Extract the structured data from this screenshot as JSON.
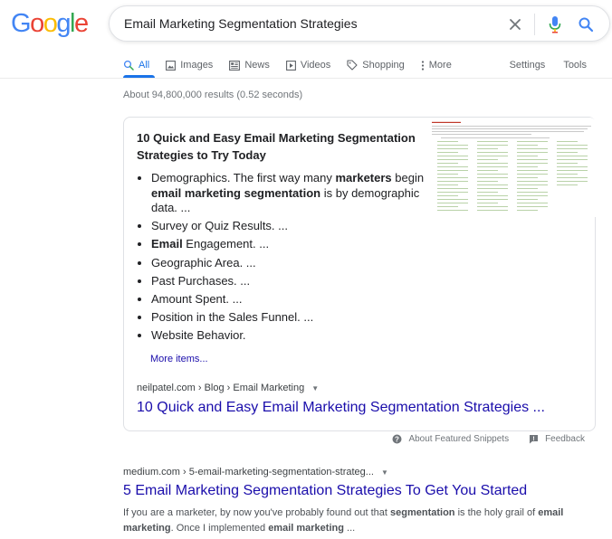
{
  "logo": {
    "letters": [
      "G",
      "o",
      "o",
      "g",
      "l",
      "e"
    ],
    "colors": [
      "#4285F4",
      "#EA4335",
      "#FBBC05",
      "#4285F4",
      "#34A853",
      "#EA4335"
    ]
  },
  "search": {
    "query": "Email Marketing Segmentation Strategies",
    "clear_icon": "close-icon",
    "mic_icon": "mic-icon",
    "search_icon": "search-icon"
  },
  "tabs": {
    "items": [
      {
        "label": "All",
        "icon": "search-icon",
        "active": true
      },
      {
        "label": "Images",
        "icon": "image-icon"
      },
      {
        "label": "News",
        "icon": "news-icon"
      },
      {
        "label": "Videos",
        "icon": "video-icon"
      },
      {
        "label": "Shopping",
        "icon": "tag-icon"
      },
      {
        "label": "More",
        "icon": "more-vert-icon"
      }
    ],
    "settings": "Settings",
    "tools": "Tools"
  },
  "stats": "About 94,800,000 results (0.52 seconds)",
  "featured_snippet": {
    "heading": "10 Quick and Easy Email Marketing Segmentation Strategies to Try Today",
    "items": [
      [
        {
          "t": "Demographics. The first way many "
        },
        {
          "t": "marketers",
          "b": true
        },
        {
          "t": " begin "
        },
        {
          "t": "email marketing segmentation",
          "b": true
        },
        {
          "t": " is by demographic data. ..."
        }
      ],
      [
        {
          "t": "Survey or Quiz Results. ..."
        }
      ],
      [
        {
          "t": "Email",
          "b": true
        },
        {
          "t": " Engagement. ..."
        }
      ],
      [
        {
          "t": "Geographic Area. ..."
        }
      ],
      [
        {
          "t": "Past Purchases. ..."
        }
      ],
      [
        {
          "t": "Amount Spent. ..."
        }
      ],
      [
        {
          "t": "Position in the Sales Funnel. ..."
        }
      ],
      [
        {
          "t": "Website Behavior."
        }
      ]
    ],
    "more_items": "More items...",
    "cite": "neilpatel.com › Blog › Email Marketing",
    "link": "10 Quick and Easy Email Marketing Segmentation Strategies ..."
  },
  "snippet_footer": {
    "about": "About Featured Snippets",
    "feedback": "Feedback"
  },
  "result2": {
    "cite": "medium.com › 5-email-marketing-segmentation-strateg...",
    "title": "5 Email Marketing Segmentation Strategies To Get You Started",
    "desc": [
      {
        "t": "If you are a marketer, by now you've probably found out that "
      },
      {
        "t": "segmentation",
        "b": true
      },
      {
        "t": " is the holy grail of "
      },
      {
        "t": "email marketing",
        "b": true
      },
      {
        "t": ". Once I implemented "
      },
      {
        "t": "email marketing",
        "b": true
      },
      {
        "t": " ..."
      }
    ]
  },
  "colors": {
    "link": "#1a0dab",
    "accent": "#1a73e8",
    "text": "#202124",
    "muted": "#70757a"
  }
}
